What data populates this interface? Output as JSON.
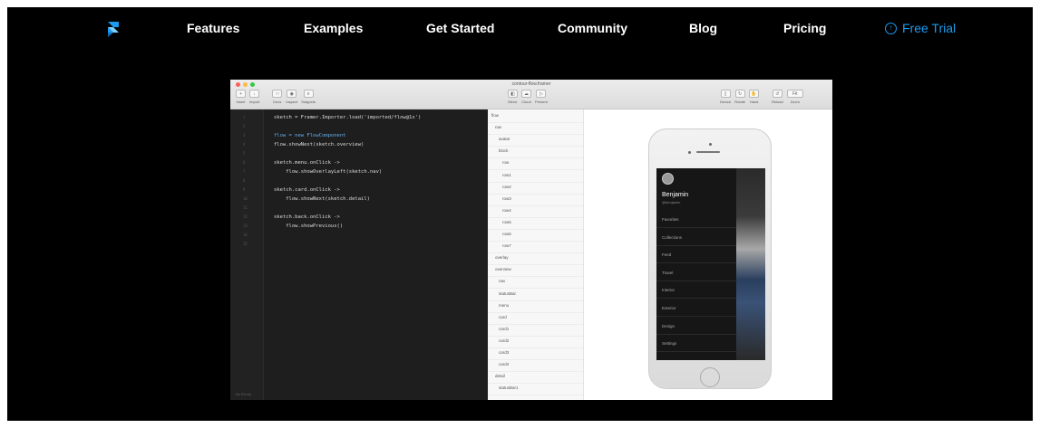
{
  "nav": {
    "items": [
      "Features",
      "Examples",
      "Get Started",
      "Community",
      "Blog",
      "Pricing"
    ],
    "trial_label": "Free Trial",
    "accent_color": "#1d9bf0"
  },
  "app": {
    "title": "contour-flow.framer",
    "toolbar_left": [
      "Insert",
      "Import",
      "Docs",
      "Inspect",
      "Snippets"
    ],
    "toolbar_center": [
      "Mirror",
      "Cloud",
      "Present"
    ],
    "toolbar_right": [
      "Device",
      "Rotate",
      "Hand",
      "Reload",
      "Zoom"
    ],
    "zoom_value": "Fit",
    "editor_status": "No Errors",
    "code": [
      "sketch = Framer.Importer.load('imported/flow@1x')",
      "flow = new FlowComponent",
      "flow.showNext(sketch.overview)",
      "sketch.menu.onClick ->",
      "    flow.showOverlayLeft(sketch.nav)",
      "sketch.card.onClick ->",
      "    flow.showNext(sketch.detail)",
      "sketch.back.onClick ->",
      "    flow.showPrevious()"
    ],
    "layers": [
      "flow",
      "nav",
      "avatar",
      "block",
      "row",
      "row1",
      "row2",
      "row3",
      "row4",
      "row5",
      "row6",
      "row7",
      "overlay",
      "overview",
      "nav",
      "statusBar",
      "menu",
      "card",
      "card1",
      "card2",
      "card3",
      "card4",
      "detail",
      "statusBar1"
    ],
    "phone": {
      "profile_name": "Benjamin",
      "profile_sub": "@benjamin",
      "menu_items": [
        "Favorites",
        "Collections",
        "Feed",
        "Travel",
        "Interior",
        "Exterior",
        "Design",
        "Settings"
      ]
    }
  }
}
